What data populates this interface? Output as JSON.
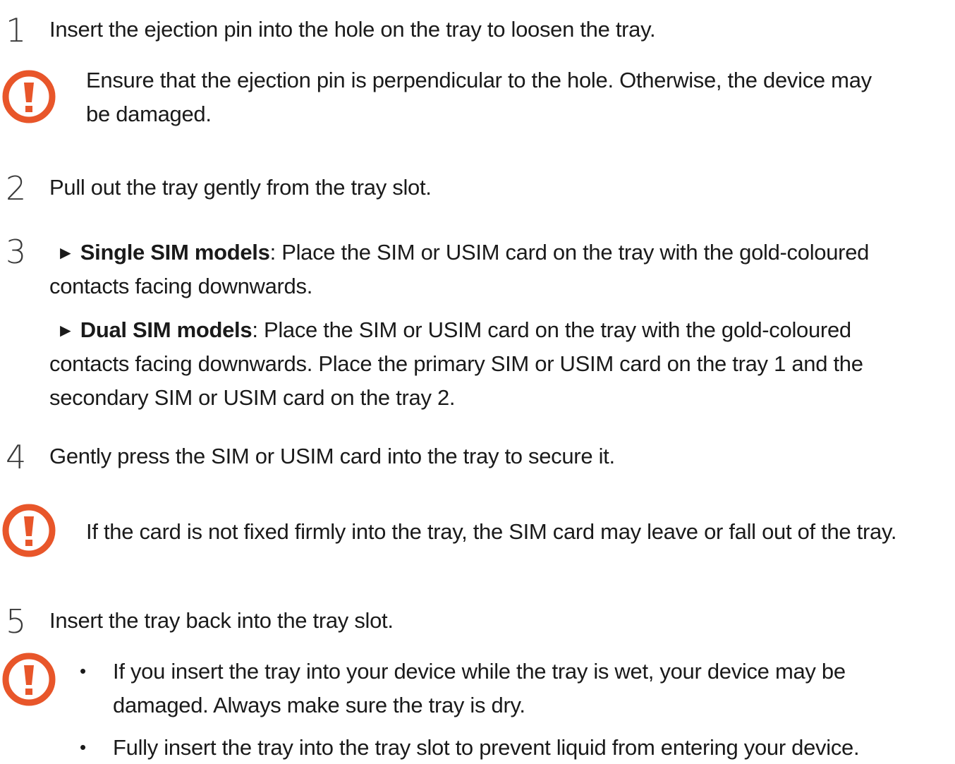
{
  "colors": {
    "caution": "#e8562a",
    "text": "#1a1a1a"
  },
  "steps": [
    {
      "num": "1",
      "text": "Insert the ejection pin into the hole on the tray to loosen the tray."
    },
    {
      "num": "2",
      "text": "Pull out the tray gently from the tray slot."
    },
    {
      "num": "3",
      "arrow": "►",
      "single_label": "Single SIM models",
      "single_line1": ": Place the SIM or USIM card on the tray with the gold-coloured",
      "single_line2": "contacts facing downwards.",
      "dual_label": "Dual SIM models",
      "dual_line1": ": Place the SIM or USIM card on the tray with the gold-coloured",
      "dual_line2": "contacts facing downwards. Place the primary SIM or USIM card on the tray 1 and the",
      "dual_line3": "secondary SIM or USIM card on the tray 2."
    },
    {
      "num": "4",
      "text": "Gently press the SIM or USIM card into the tray to secure it."
    },
    {
      "num": "5",
      "text": "Insert the tray back into the tray slot."
    }
  ],
  "cautions": [
    {
      "icon": "caution-icon",
      "line1": "Ensure that the ejection pin is perpendicular to the hole. Otherwise, the device may",
      "line2": "be damaged."
    },
    {
      "icon": "caution-icon",
      "line1": "If the card is not fixed firmly into the tray, the SIM card may leave or fall out of the tray."
    },
    {
      "icon": "caution-icon",
      "bullet": "•",
      "b1_line1": "If you insert the tray into your device while the tray is wet, your device may be",
      "b1_line2": "damaged. Always make sure the tray is dry.",
      "b2_line1": "Fully insert the tray into the tray slot to prevent liquid from entering your device."
    }
  ]
}
